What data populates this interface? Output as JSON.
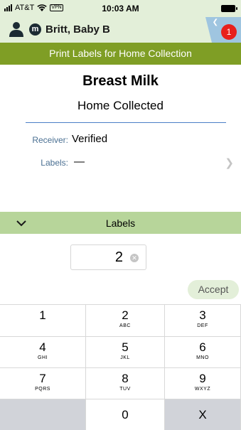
{
  "status_bar": {
    "carrier": "AT&T",
    "vpn": "VPN",
    "time": "10:03 AM"
  },
  "patient": {
    "name": "Britt, Baby B",
    "gender_badge": "m",
    "notification_count": "1"
  },
  "header": {
    "title": "Print Labels for Home Collection"
  },
  "product": {
    "name": "Breast Milk",
    "subtitle": "Home Collected"
  },
  "fields": {
    "receiver_label": "Receiver:",
    "receiver_value": "Verified",
    "labels_label": "Labels:",
    "labels_value": "—"
  },
  "labels_section": {
    "title": "Labels",
    "quantity": "2",
    "accept_label": "Accept"
  },
  "keypad": {
    "keys": [
      {
        "digit": "1",
        "letters": ""
      },
      {
        "digit": "2",
        "letters": "ABC"
      },
      {
        "digit": "3",
        "letters": "DEF"
      },
      {
        "digit": "4",
        "letters": "GHI"
      },
      {
        "digit": "5",
        "letters": "JKL"
      },
      {
        "digit": "6",
        "letters": "MNO"
      },
      {
        "digit": "7",
        "letters": "PQRS"
      },
      {
        "digit": "8",
        "letters": "TUV"
      },
      {
        "digit": "9",
        "letters": "WXYZ"
      },
      {
        "digit": "",
        "letters": ""
      },
      {
        "digit": "0",
        "letters": ""
      },
      {
        "digit": "X",
        "letters": ""
      }
    ]
  },
  "colors": {
    "title_bar": "#7f9e25",
    "patient_bar": "#e3efd9",
    "labels_section": "#b7d59a",
    "notification": "#e8201c"
  }
}
